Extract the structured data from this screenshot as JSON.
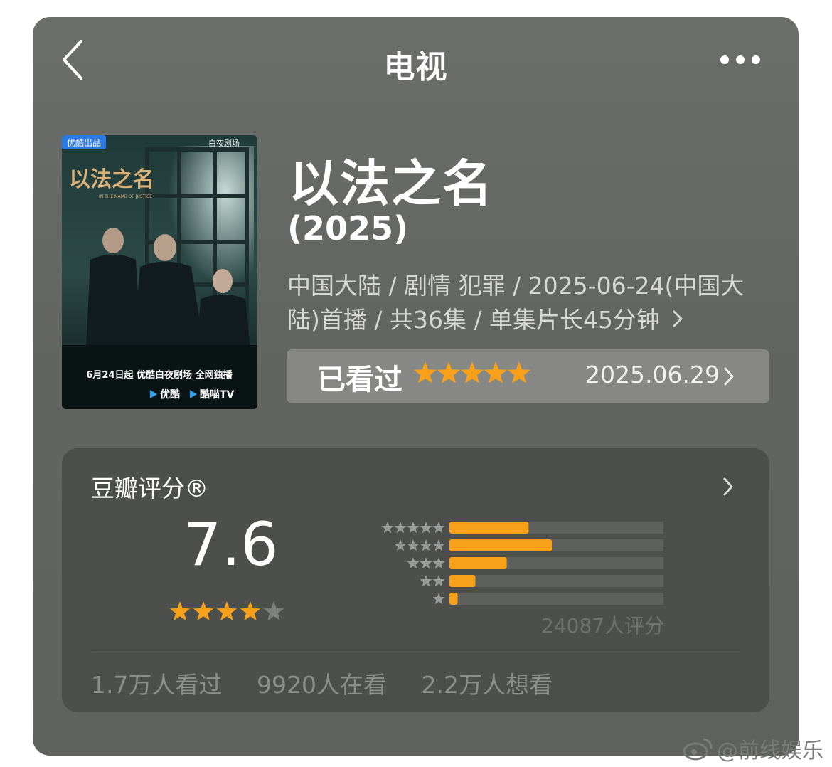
{
  "header": {
    "title": "电视",
    "back_icon": "chevron-left-icon",
    "more_icon": "more-horizontal-icon"
  },
  "poster": {
    "badge": "优酷出品",
    "brand": "白夜剧场",
    "title_art": "以法之名",
    "subtitle_en": "IN THE NAME OF JUSTICE",
    "release_line": "6月24日起 优酷白夜剧场 全网独播",
    "platform_1": "优酷",
    "platform_2": "酷喵TV"
  },
  "meta": {
    "title": "以法之名",
    "year": "(2025)",
    "info": "中国大陆 / 剧情 犯罪 / 2025-06-24(中国大陆)首播 / 共36集 / 单集片长45分钟"
  },
  "watched": {
    "label": "已看过",
    "user_rating": 5,
    "date": "2025.06.29"
  },
  "rating": {
    "title": "豆瓣评分®",
    "score": "7.6",
    "stars": 4,
    "count_text": "24087人评分",
    "distribution": [
      {
        "stars": 5,
        "fraction": 0.29
      },
      {
        "stars": 4,
        "fraction": 0.375
      },
      {
        "stars": 3,
        "fraction": 0.21
      },
      {
        "stars": 2,
        "fraction": 0.095
      },
      {
        "stars": 1,
        "fraction": 0.03
      }
    ],
    "stats": [
      "1.7万人看过",
      "9920人在看",
      "2.2万人想看"
    ]
  },
  "watermark": "@前线娱乐",
  "colors": {
    "star": "#f8a019",
    "bar_fill": "#f8a019",
    "bar_track": "#5e605d",
    "card_bg": "#666865",
    "rating_bg": "#4d4f4c"
  }
}
